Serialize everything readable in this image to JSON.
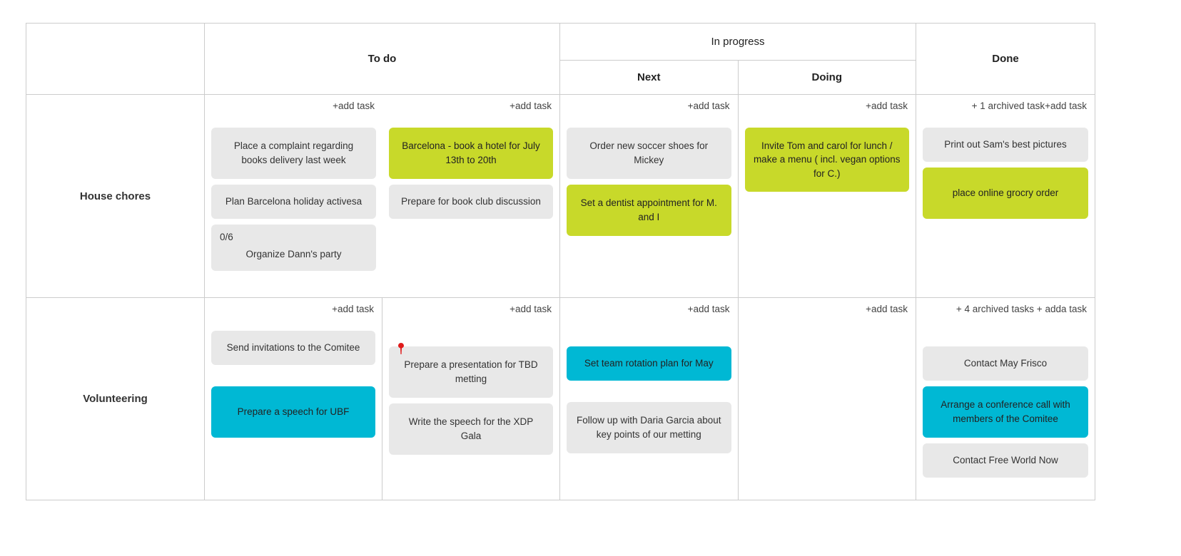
{
  "board": {
    "columns": {
      "todo": "To do",
      "in_progress": "In progress",
      "in_progress_sub": [
        "Next",
        "Doing"
      ],
      "done": "Done"
    },
    "actions": {
      "add_task": "+add task",
      "archived_house_done": "+ 1 archived task",
      "archived_volunteering_done": "+ 4 archived tasks + add",
      "add_task_compact": "a task"
    },
    "lanes": [
      {
        "name": "House chores",
        "todo_left": {
          "add": "+add task",
          "cards": [
            {
              "text": "Place a complaint regarding books delivery last week",
              "color": "grey",
              "size": "tall"
            },
            {
              "text": "Plan Barcelona holiday activesa",
              "color": "grey",
              "size": "normal"
            },
            {
              "text": "Organize Dann's party",
              "color": "grey",
              "size": "checklist",
              "checklist": "0/6"
            }
          ]
        },
        "todo_right": {
          "add": "+add task",
          "cards": [
            {
              "text": "Barcelona - book a hotel for July 13th to 20th",
              "color": "lime",
              "size": "tall"
            },
            {
              "text": "Prepare for book club discussion",
              "color": "grey",
              "size": "normal"
            }
          ]
        },
        "next": {
          "add": "+add task",
          "cards": [
            {
              "text": "Order new soccer shoes for Mickey",
              "color": "grey",
              "size": "tall"
            },
            {
              "text": "Set a dentist appointment for M. and I",
              "color": "lime",
              "size": "tall"
            }
          ]
        },
        "doing": {
          "add": "+add task",
          "cards": [
            {
              "text": "Invite Tom and carol for lunch / make a menu ( incl. vegan options for C.)",
              "color": "lime",
              "size": "tallest"
            }
          ]
        },
        "done": {
          "archived": "+ 1 archived task",
          "add": "+add task",
          "cards": [
            {
              "text": "Print out Sam's best pictures",
              "color": "grey",
              "size": "normal"
            },
            {
              "text": "place online grocry order",
              "color": "lime",
              "size": "tall"
            }
          ]
        }
      },
      {
        "name": "Volunteering",
        "todo_left": {
          "add": "+add task",
          "cards": [
            {
              "text": "Send invitations to the Comitee",
              "color": "grey",
              "size": "normal"
            },
            {
              "text": "Prepare a speech for UBF",
              "color": "cyan",
              "size": "tall"
            }
          ]
        },
        "todo_right": {
          "add": "+add task",
          "cards": [
            {
              "text": "Prepare a presentation for TBD metting",
              "color": "grey",
              "size": "tall",
              "pin": "pin-icon"
            },
            {
              "text": "Write the speech for the XDP Gala",
              "color": "grey",
              "size": "tall"
            }
          ]
        },
        "next": {
          "add": "+add task",
          "cards": [
            {
              "text": "Set team rotation plan for May",
              "color": "cyan",
              "size": "normal"
            },
            {
              "text": "Follow up with Daria Garcia about key points of our metting",
              "color": "grey",
              "size": "tall"
            }
          ]
        },
        "doing": {
          "add": "+add task",
          "cards": []
        },
        "done": {
          "archived": "+ 4 archived tasks + add",
          "add": "a task",
          "cards": [
            {
              "text": "Contact May Frisco",
              "color": "grey",
              "size": "normal"
            },
            {
              "text": "Arrange a conference call with members of the Comitee",
              "color": "cyan",
              "size": "tall"
            },
            {
              "text": "Contact Free World Now",
              "color": "grey",
              "size": "normal"
            }
          ]
        }
      }
    ]
  },
  "colors": {
    "lime": "#c8d92a",
    "cyan": "#00b8d4",
    "grey": "#e8e8e8",
    "pin_red": "#e01b1b",
    "border": "#cccccc"
  }
}
